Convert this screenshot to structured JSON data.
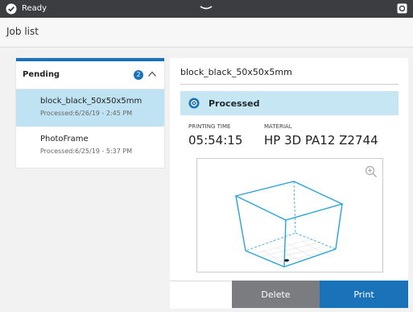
{
  "status_bar": {
    "status_text": "Ready"
  },
  "page": {
    "title": "Job list"
  },
  "job_list": {
    "group_label": "Pending",
    "count": "2",
    "items": [
      {
        "name": "block_black_50x50x5mm",
        "subtitle": "Processed:6/26/19 - 2:45 PM",
        "selected": true
      },
      {
        "name": "PhotoFrame",
        "subtitle": "Processed:6/25/19 - 5:37 PM",
        "selected": false
      }
    ]
  },
  "detail": {
    "title": "block_black_50x50x5mm",
    "status": "Processed",
    "printing_time_label": "PRINTING TIME",
    "printing_time": "05:54:15",
    "material_label": "MATERIAL",
    "material": "HP 3D PA12 Z2744"
  },
  "actions": {
    "delete_label": "Delete",
    "print_label": "Print"
  },
  "icons": {
    "ok": "check-circle-icon",
    "pull": "pull-down-handle-icon",
    "corner": "display-icon",
    "collapse": "chevron-up-icon",
    "status": "processed-icon",
    "zoom": "zoom-in-icon"
  },
  "colors": {
    "accent": "#1a73b8",
    "selected_row": "#bfe3f2",
    "banner": "#c5e6f2",
    "status_bar": "#3b3d40",
    "delete_button": "#7b7c7f",
    "model_outline": "#29a3d9"
  }
}
